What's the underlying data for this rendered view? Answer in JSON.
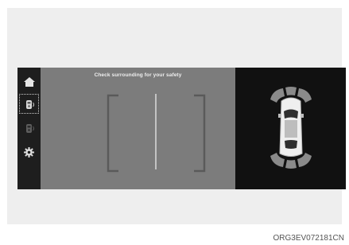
{
  "camera": {
    "hint_text": "Check surrounding for your safety"
  },
  "sidebar": {
    "items": [
      {
        "icon": "home-icon"
      },
      {
        "icon": "rear-view-camera-icon",
        "selected": true
      },
      {
        "icon": "top-view-camera-icon",
        "selected": false
      },
      {
        "icon": "settings-gear-icon"
      }
    ]
  },
  "sensor_view": {
    "icon": "parking-sensor-car-icon"
  },
  "caption": "ORG3EV072181CN",
  "colors": {
    "camera_background": "#7c7c7c",
    "guide_lines": "#5a5a5a",
    "center_line": "#dcdcdc",
    "sensor_zones": "#8a8a8a"
  }
}
